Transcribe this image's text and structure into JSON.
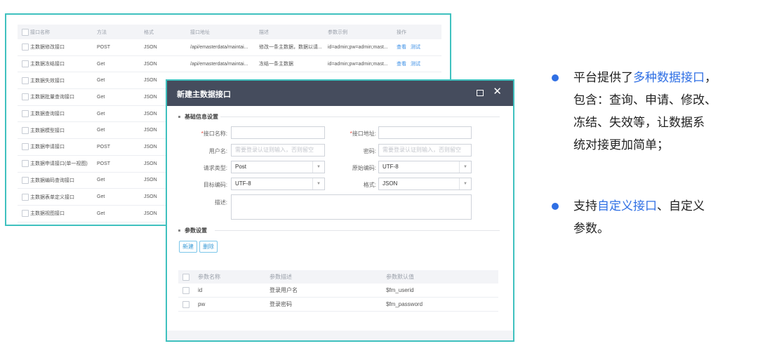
{
  "list": {
    "headers": [
      "接口名称",
      "方法",
      "格式",
      "接口地址",
      "描述",
      "参数示例",
      "操作"
    ],
    "rows": [
      {
        "name": "主数据修改接口",
        "method": "POST",
        "format": "JSON",
        "url": "/api/emasterdata/maintai...",
        "desc": "修改一条主数据，数据以请...",
        "param": "id=admin;pw=admin;mast..."
      },
      {
        "name": "主数据冻结接口",
        "method": "Get",
        "format": "JSON",
        "url": "/api/emasterdata/maintai...",
        "desc": "冻结一条主数据",
        "param": "id=admin;pw=admin;mast..."
      },
      {
        "name": "主数据失效接口",
        "method": "Get",
        "format": "JSON",
        "url": "",
        "desc": "",
        "param": ""
      },
      {
        "name": "主数据批量查询接口",
        "method": "Get",
        "format": "JSON",
        "url": "",
        "desc": "",
        "param": ""
      },
      {
        "name": "主数据查询接口",
        "method": "Get",
        "format": "JSON",
        "url": "",
        "desc": "",
        "param": ""
      },
      {
        "name": "主数据模型接口",
        "method": "Get",
        "format": "JSON",
        "url": "",
        "desc": "",
        "param": ""
      },
      {
        "name": "主数据申请接口",
        "method": "POST",
        "format": "JSON",
        "url": "",
        "desc": "",
        "param": ""
      },
      {
        "name": "主数据申请接口(单一视图)",
        "method": "POST",
        "format": "JSON",
        "url": "",
        "desc": "",
        "param": ""
      },
      {
        "name": "主数据编码查询接口",
        "method": "Get",
        "format": "JSON",
        "url": "",
        "desc": "",
        "param": ""
      },
      {
        "name": "主数据表单定义接口",
        "method": "Get",
        "format": "JSON",
        "url": "",
        "desc": "",
        "param": ""
      },
      {
        "name": "主数据视图接口",
        "method": "Get",
        "format": "JSON",
        "url": "",
        "desc": "",
        "param": ""
      }
    ],
    "actions": {
      "view": "查看",
      "test": "测试"
    }
  },
  "dialog": {
    "title": "新建主数据接口",
    "section_basic": "基础信息设置",
    "section_params": "参数设置",
    "fields": {
      "name_label": "接口名称:",
      "address_label": "接口地址:",
      "user_label": "用户名:",
      "user_placeholder": "需要登录认证则输入，否则留空",
      "password_label": "密码:",
      "password_placeholder": "需要登录认证则输入，否则留空",
      "request_type_label": "请求类型:",
      "request_type_value": "Post",
      "source_encoding_label": "原始编码:",
      "source_encoding_value": "UTF-8",
      "target_encoding_label": "目标编码:",
      "target_encoding_value": "UTF-8",
      "format_label": "格式:",
      "format_value": "JSON",
      "desc_label": "描述:",
      "required_mark": "*"
    },
    "buttons": {
      "new": "新建",
      "delete": "删除"
    },
    "param_table": {
      "headers": [
        "参数名称",
        "参数描述",
        "参数默认值"
      ],
      "rows": [
        {
          "name": "id",
          "desc": "登录用户名",
          "default": "$fm_userid"
        },
        {
          "name": "pw",
          "desc": "登录密码",
          "default": "$fm_password"
        }
      ]
    }
  },
  "bullets": {
    "b1_pre": "平台提供了",
    "b1_hl": "多种数据接口",
    "b1_line1_end": "，",
    "b1_line2": "包含：查询、申请、修改、",
    "b1_line3": "冻结、失效等，让数据系",
    "b1_line4": "统对接更加简单；",
    "b2_pre": "支持",
    "b2_hl": "自定义接口",
    "b2_post": "、自定义",
    "b2_line2": "参数。"
  },
  "colors": {
    "accent": "#2f6fe4",
    "teal_border": "#3fc1bf",
    "titlebar": "#454c5d"
  }
}
